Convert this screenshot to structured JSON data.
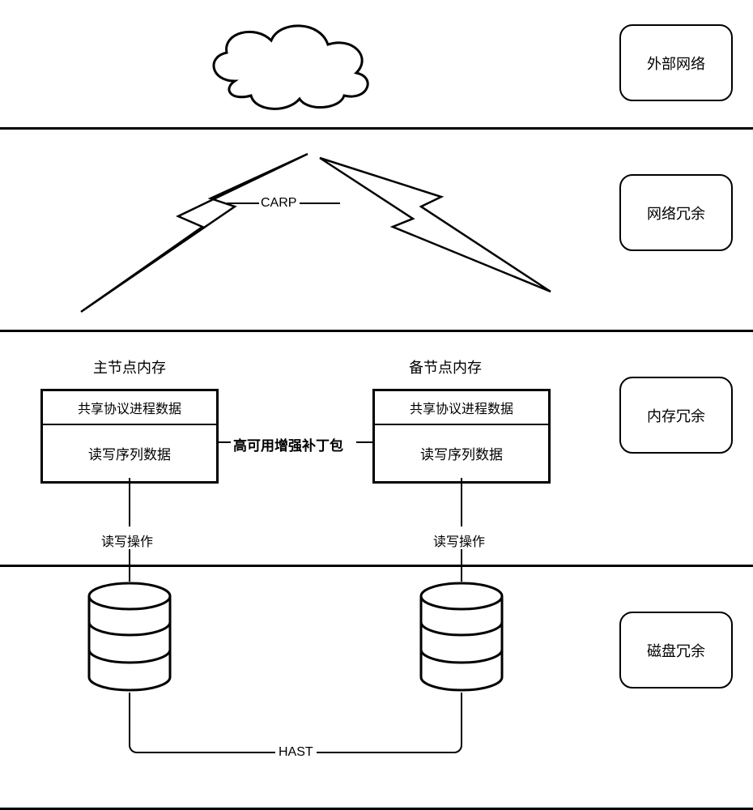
{
  "layers": {
    "external_network": "外部网络",
    "network_redundancy": "网络冗余",
    "memory_redundancy": "内存冗余",
    "disk_redundancy": "磁盘冗余"
  },
  "protocols": {
    "carp": "CARP",
    "hast": "HAST"
  },
  "nodes": {
    "primary_title": "主节点内存",
    "backup_title": "备节点内存",
    "shared_protocol_data": "共享协议进程数据",
    "rw_sequence_data": "读写序列数据"
  },
  "center_link": "高可用增强补丁包",
  "rw_operation": "读写操作"
}
